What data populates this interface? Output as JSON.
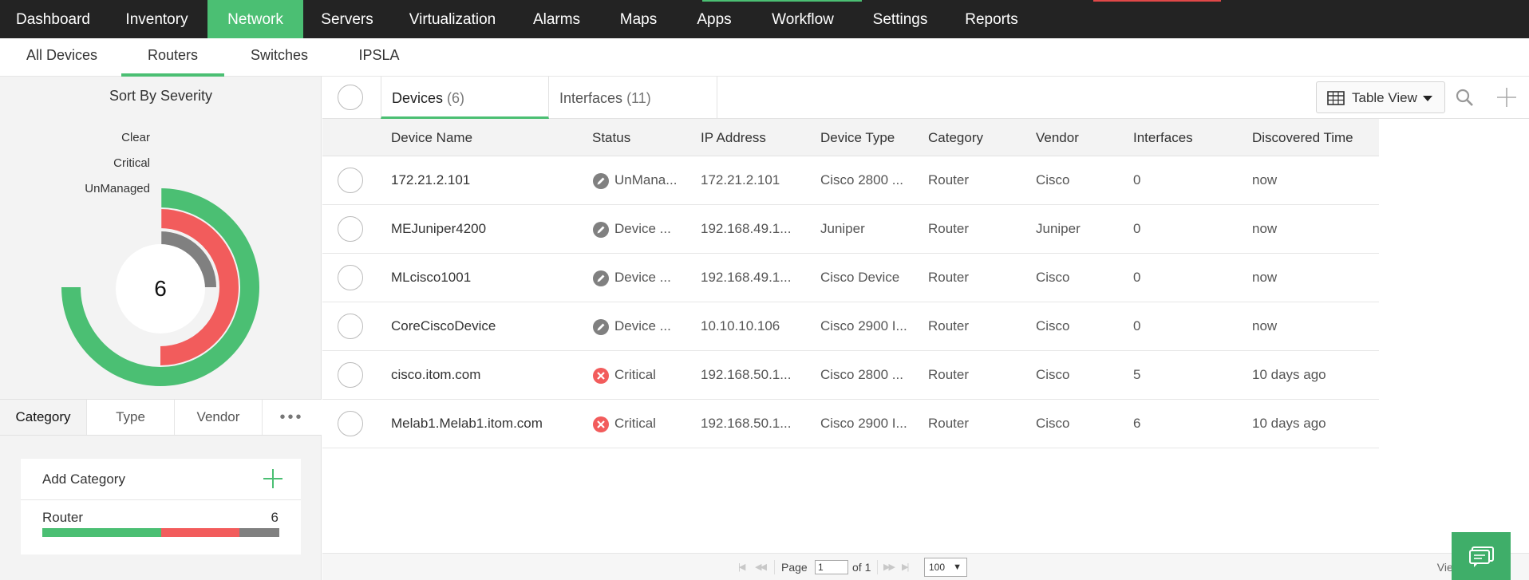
{
  "topnav": {
    "items": [
      "Dashboard",
      "Inventory",
      "Network",
      "Servers",
      "Virtualization",
      "Alarms",
      "Maps",
      "Apps",
      "Workflow",
      "Settings",
      "Reports"
    ],
    "active": "Network"
  },
  "subnav": {
    "items": [
      "All Devices",
      "Routers",
      "Switches",
      "IPSLA"
    ],
    "active": "Routers"
  },
  "severity": {
    "title": "Sort By Severity",
    "rings": [
      {
        "label": "Clear",
        "color": "#4bbf73",
        "fraction": 0.75
      },
      {
        "label": "Critical",
        "color": "#f25c5c",
        "fraction": 0.5
      },
      {
        "label": "UnManaged",
        "color": "#808080",
        "fraction": 0.25
      }
    ],
    "total": "6"
  },
  "category_tabs": {
    "items": [
      "Category",
      "Type",
      "Vendor"
    ],
    "more": "•••",
    "active": "Category"
  },
  "category_card": {
    "add_label": "Add Category",
    "row_label": "Router",
    "row_count": "6",
    "bar": [
      {
        "color": "#4bbf73",
        "fraction": 0.5
      },
      {
        "color": "#f25c5c",
        "fraction": 0.333
      },
      {
        "color": "#808080",
        "fraction": 0.167
      }
    ]
  },
  "main": {
    "tabs": {
      "devices_label": "Devices",
      "devices_count": "(6)",
      "interfaces_label": "Interfaces",
      "interfaces_count": "(11)"
    },
    "table_view_label": "Table View",
    "columns": [
      "Device Name",
      "Status",
      "IP Address",
      "Device Type",
      "Category",
      "Vendor",
      "Interfaces",
      "Discovered Time"
    ],
    "rows": [
      {
        "name": "172.21.2.101",
        "status": "UnMana...",
        "status_kind": "unmanaged",
        "ip": "172.21.2.101",
        "type": "Cisco 2800 ...",
        "category": "Router",
        "vendor": "Cisco",
        "interfaces": "0",
        "discovered": "now"
      },
      {
        "name": "MEJuniper4200",
        "status": "Device ...",
        "status_kind": "unmanaged",
        "ip": "192.168.49.1...",
        "type": "Juniper",
        "category": "Router",
        "vendor": "Juniper",
        "interfaces": "0",
        "discovered": "now"
      },
      {
        "name": "MLcisco1001",
        "status": "Device ...",
        "status_kind": "unmanaged",
        "ip": "192.168.49.1...",
        "type": "Cisco Device",
        "category": "Router",
        "vendor": "Cisco",
        "interfaces": "0",
        "discovered": "now"
      },
      {
        "name": "CoreCiscoDevice",
        "status": "Device ...",
        "status_kind": "unmanaged",
        "ip": "10.10.10.106",
        "type": "Cisco 2900 I...",
        "category": "Router",
        "vendor": "Cisco",
        "interfaces": "0",
        "discovered": "now"
      },
      {
        "name": "cisco.itom.com",
        "status": "Critical",
        "status_kind": "critical",
        "ip": "192.168.50.1...",
        "type": "Cisco 2800 ...",
        "category": "Router",
        "vendor": "Cisco",
        "interfaces": "5",
        "discovered": "10 days ago"
      },
      {
        "name": "Melab1.Melab1.itom.com",
        "status": "Critical",
        "status_kind": "critical",
        "ip": "192.168.50.1...",
        "type": "Cisco 2900 I...",
        "category": "Router",
        "vendor": "Cisco",
        "interfaces": "6",
        "discovered": "10 days ago"
      }
    ]
  },
  "footer": {
    "page_label": "Page",
    "page_value": "1",
    "of_label": "of 1",
    "page_size": "100",
    "view_info": "View 1 - 6 of 6"
  },
  "colors": {
    "accent": "#4bbf73",
    "critical": "#f25c5c",
    "unmanaged": "#808080",
    "nav_bg": "#232323"
  },
  "icons": [
    "table-icon",
    "caret-down-icon",
    "search-icon",
    "plus-icon",
    "pencil-icon",
    "close-icon",
    "chat-icon"
  ]
}
